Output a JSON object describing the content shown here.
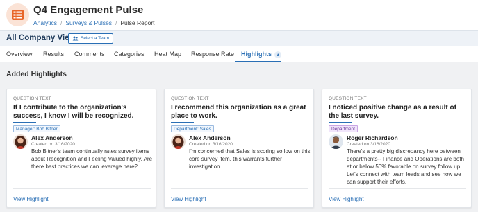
{
  "app": {
    "title": "Q4 Engagement Pulse",
    "icon": "list-grid-icon",
    "accent_color": "#e8662a"
  },
  "breadcrumb": [
    "Analytics",
    "Surveys & Pulses",
    "Pulse Report"
  ],
  "viewbar": {
    "title": "All Company View",
    "select_team_label": "Select a Team",
    "select_team_icon": "team-icon"
  },
  "tabs": [
    {
      "label": "Overview"
    },
    {
      "label": "Results"
    },
    {
      "label": "Comments"
    },
    {
      "label": "Categories"
    },
    {
      "label": "Heat Map"
    },
    {
      "label": "Response Rate"
    },
    {
      "label": "Highlights",
      "badge": "3",
      "active": true
    }
  ],
  "section_title": "Added Highlights",
  "cards": [
    {
      "question_label": "QUESTION TEXT",
      "question": "If I contribute to the organization's success, I know I will be recognized.",
      "tag": "Manager: Bob Bitner",
      "tag_color": "#2a6fb5",
      "author": "Alex Anderson",
      "created": "Created on 3/16/2020",
      "comment": "Bob Bitner's team continually rates survey items about Recognition and Feeling Valued highly. Are there best practices we can leverage here?",
      "link": "View Highlight"
    },
    {
      "question_label": "QUESTION TEXT",
      "question": "I recommend this organization as a great place to work.",
      "tag": "Department: Sales",
      "tag_color": "#2a6fb5",
      "author": "Alex Anderson",
      "created": "Created on 3/16/2020",
      "comment": "I'm concerned that Sales is scoring so low on this core survey item, this warrants further investigation.",
      "link": "View Highlight"
    },
    {
      "question_label": "QUESTION TEXT",
      "question": "I noticed positive change as a result of the last survey.",
      "tag": "Department",
      "tag_color": "#6d3a9c",
      "author": "Roger Richardson",
      "created": "Created on 3/16/2020",
      "comment": "There's a pretty big discrepancy here between departments-- Finance and Operations are both at or below 50% favorable on survey follow up. Let's connect with team leads and see how we can support their efforts.",
      "link": "View Highlight"
    }
  ]
}
